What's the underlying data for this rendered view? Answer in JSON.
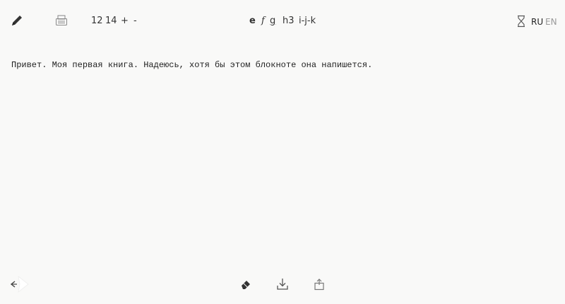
{
  "toolbar": {
    "icons": {
      "pencil": "pencil-icon",
      "typewriter": "typewriter-icon",
      "hourglass": "hourglass-icon"
    },
    "font_sizes": [
      "12",
      "14"
    ],
    "increase_label": "+",
    "decrease_label": "-",
    "format_labels": {
      "bold": "e",
      "italic": "f",
      "underline": "g",
      "heading": "h3",
      "indent": "i-j-k"
    },
    "languages": {
      "ru": "RU",
      "en": "EN"
    }
  },
  "editor": {
    "text": "Привет. Моя первая книга. Надеюсь, хотя бы этом блокноте она напишется."
  },
  "footer": {
    "icons": {
      "collapse": "collapse-arrow-icon",
      "eraser": "eraser-icon",
      "download": "download-icon",
      "share": "share-icon"
    }
  },
  "colors": {
    "background": "#f9f9f8",
    "text": "#222222",
    "muted": "#999999",
    "icon": "#555555"
  }
}
